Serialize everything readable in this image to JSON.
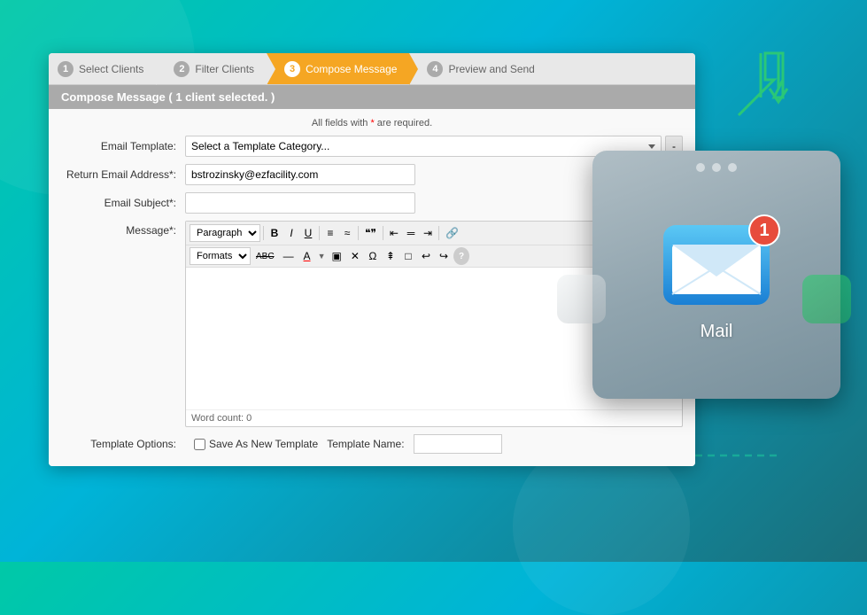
{
  "wizard": {
    "steps": [
      {
        "num": "1",
        "label": "Select Clients",
        "active": false
      },
      {
        "num": "2",
        "label": "Filter Clients",
        "active": false
      },
      {
        "num": "3",
        "label": "Compose Message",
        "active": true
      },
      {
        "num": "4",
        "label": "Preview and Send",
        "active": false
      }
    ]
  },
  "panel": {
    "heading": "Compose Message ( 1 client selected. )",
    "required_note": "All fields with * are required.",
    "required_star": "*"
  },
  "form": {
    "email_template_label": "Email Template:",
    "email_template_placeholder": "Select a Template Category...",
    "email_template_btn": "-",
    "return_email_label": "Return Email Address*:",
    "return_email_value": "bstrozinsky@ezfacility.com",
    "email_subject_label": "Email Subject*:",
    "email_subject_value": "",
    "message_label": "Message*:"
  },
  "editor": {
    "paragraph_select": "Paragraph",
    "toolbar_buttons": [
      "B",
      "I",
      "U",
      "≡",
      "≡",
      "\"\"",
      "≡",
      "≡",
      "≡",
      "🔗"
    ],
    "toolbar2_buttons": [
      "Formats",
      "ABC",
      "—",
      "A",
      "▼",
      "⬡",
      "✕",
      "Ω",
      "⟺",
      "⬜",
      "↩",
      "↪",
      "?"
    ],
    "word_count_label": "Word count: 0"
  },
  "template_options": {
    "label": "Template Options:",
    "save_checkbox_label": "Save As New Template",
    "template_name_label": "Template Name:",
    "template_name_value": ""
  },
  "mail": {
    "label": "Mail",
    "badge": "1"
  }
}
